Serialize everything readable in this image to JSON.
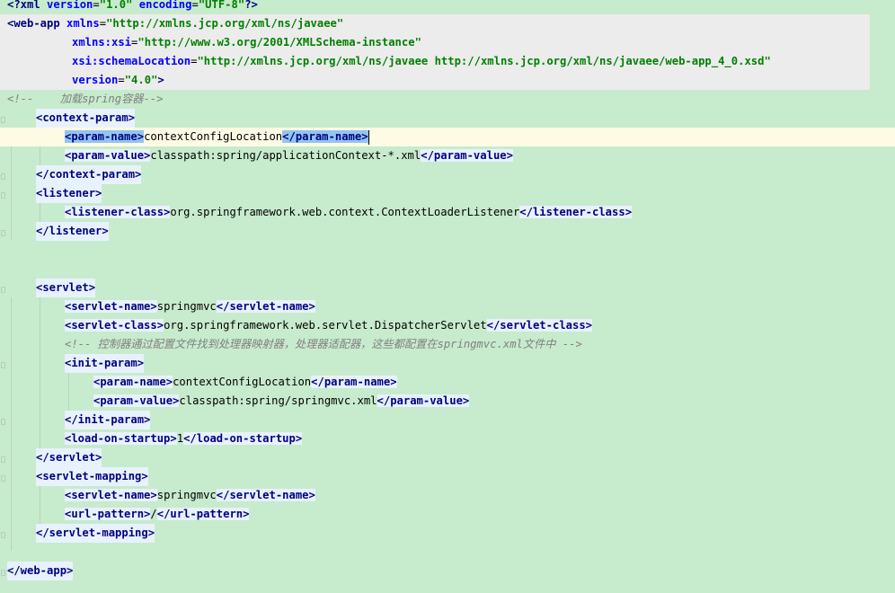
{
  "editor": {
    "language": "XML",
    "colors": {
      "background": "#c7ebcd",
      "tag_bg": "#e8f2fe",
      "tag_text": "#000080",
      "attribute": "#0000ff",
      "value": "#008000",
      "comment": "#808080",
      "current_line": "#fffae3",
      "brace_match": "#93c4f2"
    },
    "lines": {
      "l1": {
        "pi_open": "<?xml",
        "a1": "version",
        "v1": "\"1.0\"",
        "a2": "encoding",
        "v2": "\"UTF-8\"",
        "pi_close": "?>"
      },
      "l2": {
        "tag": "<web-app",
        "attr": "xmlns",
        "value": "\"http://xmlns.jcp.org/xml/ns/javaee\""
      },
      "l3": {
        "attr_prefix": "xmlns:",
        "attr": "xsi",
        "value": "\"http://www.w3.org/2001/XMLSchema-instance\""
      },
      "l4": {
        "attr_prefix": "xsi:",
        "attr": "schemaLocation",
        "value": "\"http://xmlns.jcp.org/xml/ns/javaee http://xmlns.jcp.org/xml/ns/javaee/web-app_4_0.xsd\""
      },
      "l5": {
        "attr": "version",
        "value": "\"4.0\"",
        "close": ">"
      },
      "l6": {
        "comment": "<!--    加载spring容器-->"
      },
      "l7": {
        "tag": "<context-param>"
      },
      "l8": {
        "open": "<param-name>",
        "text": "contextConfigLocation",
        "close": "</param-name>"
      },
      "l9": {
        "open": "<param-value>",
        "text": "classpath:spring/applicationContext-*.xml",
        "close": "</param-value>"
      },
      "l10": {
        "tag": "</context-param>"
      },
      "l11": {
        "tag": "<listener>"
      },
      "l12": {
        "open": "<listener-class>",
        "text": "org.springframework.web.context.ContextLoaderListener",
        "close": "</listener-class>"
      },
      "l13": {
        "tag": "</listener>"
      },
      "l16": {
        "tag": "<servlet>"
      },
      "l17": {
        "open": "<servlet-name>",
        "text": "springmvc",
        "close": "</servlet-name>"
      },
      "l18": {
        "open": "<servlet-class>",
        "text": "org.springframework.web.servlet.DispatcherServlet",
        "close": "</servlet-class>"
      },
      "l19": {
        "comment": "<!-- 控制器通过配置文件找到处理器映射器，处理器适配器，这些都配置在springmvc.xml文件中 -->"
      },
      "l20": {
        "tag": "<init-param>"
      },
      "l21": {
        "open": "<param-name>",
        "text": "contextConfigLocation",
        "close": "</param-name>"
      },
      "l22": {
        "open": "<param-value>",
        "text": "classpath:spring/springmvc.xml",
        "close": "</param-value>"
      },
      "l23": {
        "tag": "</init-param>"
      },
      "l24": {
        "open": "<load-on-startup>",
        "text": "1",
        "close": "</load-on-startup>"
      },
      "l25": {
        "tag": "</servlet>"
      },
      "l26": {
        "tag": "<servlet-mapping>"
      },
      "l27": {
        "open": "<servlet-name>",
        "text": "springmvc",
        "close": "</servlet-name>"
      },
      "l28": {
        "open": "<url-pattern>",
        "text": "/",
        "close": "</url-pattern>"
      },
      "l29": {
        "tag": "</servlet-mapping>"
      },
      "l31": {
        "tag": "</web-app>"
      }
    }
  }
}
